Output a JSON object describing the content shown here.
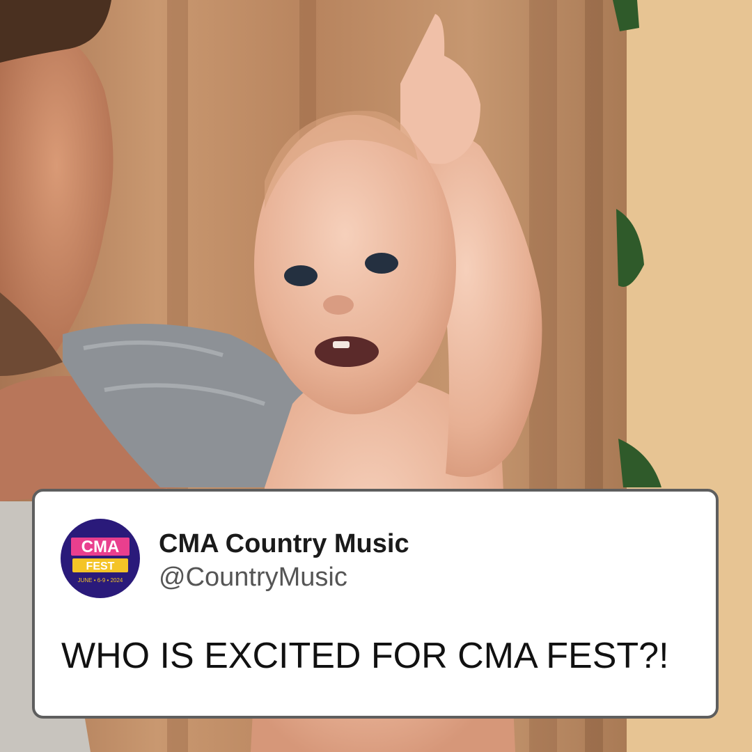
{
  "tweet": {
    "display_name": "CMA Country Music",
    "handle": "@CountryMusic",
    "text": "WHO IS EXCITED FOR CMA FEST?!"
  },
  "avatar": {
    "logo_letters": "CMA",
    "logo_word": "FEST",
    "logo_dates": "JUNE • 6-9 • 2024"
  },
  "photo": {
    "subject": "baby-raising-finger",
    "background": "curtain"
  },
  "colors": {
    "card_background": "#ffffff",
    "card_border": "#5e5e5e",
    "avatar_background": "#2a1a7a",
    "curtain": "#c08a62",
    "wall": "#e7c493"
  }
}
